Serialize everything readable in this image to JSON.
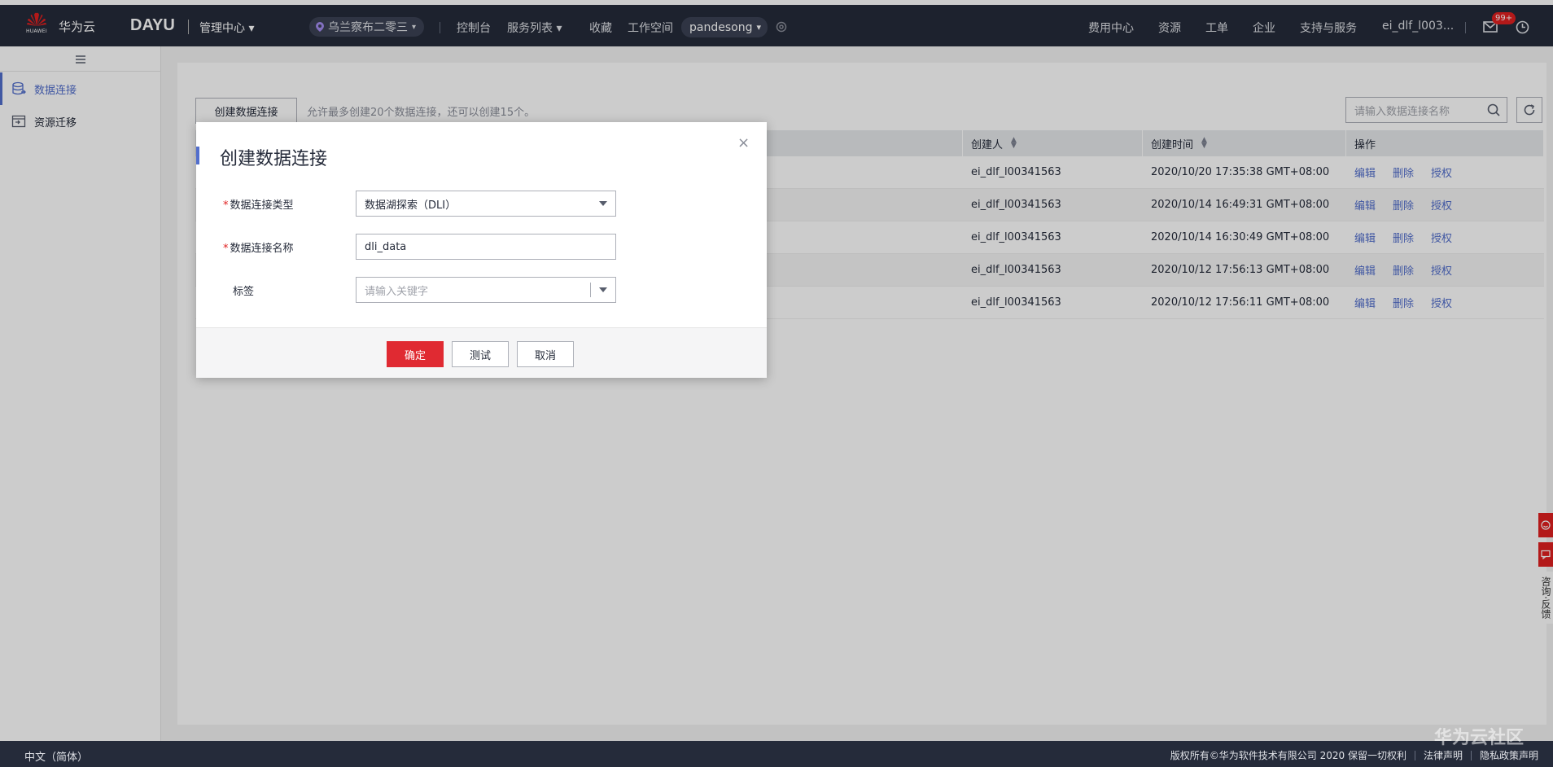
{
  "topbar": {
    "logo_text": "HUAWEI",
    "brand": "华为云",
    "product": "DAYU",
    "management": "管理中心 ▾",
    "region": "乌兰察布二零三",
    "nav": [
      "控制台",
      "服务列表 ▾",
      "收藏",
      "工作空间"
    ],
    "workspace": "pandesong",
    "right_nav": [
      "费用中心",
      "资源",
      "工单",
      "企业",
      "支持与服务",
      "ei_dlf_l003..."
    ],
    "badge": "99+"
  },
  "sidebar": {
    "items": [
      {
        "label": "数据连接",
        "active": true
      },
      {
        "label": "资源迁移",
        "active": false
      }
    ]
  },
  "toolbar": {
    "create_label": "创建数据连接",
    "hint": "允许最多创建20个数据连接，还可以创建15个。",
    "search_placeholder": "请输入数据连接名称"
  },
  "table": {
    "headers": [
      "",
      "",
      "",
      "创建人",
      "创建时间",
      "操作"
    ],
    "rows": [
      {
        "creator": "ei_dlf_l00341563",
        "time": "2020/10/20 17:35:38 GMT+08:00"
      },
      {
        "creator": "ei_dlf_l00341563",
        "time": "2020/10/14 16:49:31 GMT+08:00"
      },
      {
        "creator": "ei_dlf_l00341563",
        "time": "2020/10/14 16:30:49 GMT+08:00"
      },
      {
        "creator": "ei_dlf_l00341563",
        "time": "2020/10/12 17:56:13 GMT+08:00"
      },
      {
        "creator": "ei_dlf_l00341563",
        "time": "2020/10/12 17:56:11 GMT+08:00"
      }
    ],
    "actions": [
      "编辑",
      "删除",
      "授权"
    ]
  },
  "modal": {
    "title": "创建数据连接",
    "type_label": "数据连接类型",
    "type_value": "数据湖探索（DLI）",
    "name_label": "数据连接名称",
    "name_value": "dli_data",
    "tag_label": "标签",
    "tag_placeholder": "请输入关键字",
    "ok": "确定",
    "test": "测试",
    "cancel": "取消",
    "close": "×"
  },
  "footer": {
    "lang": "中文（简体）",
    "copyright": "版权所有©华为软件技术有限公司 2020 保留一切权利",
    "legal": "法律声明",
    "privacy": "隐私政策声明"
  },
  "watermark": "华为云社区",
  "float_tools": {
    "feedback": "咨询·反馈"
  },
  "colors": {
    "topbar": "#252b3a",
    "accent": "#526ecc",
    "primary_button": "#e02a32"
  }
}
